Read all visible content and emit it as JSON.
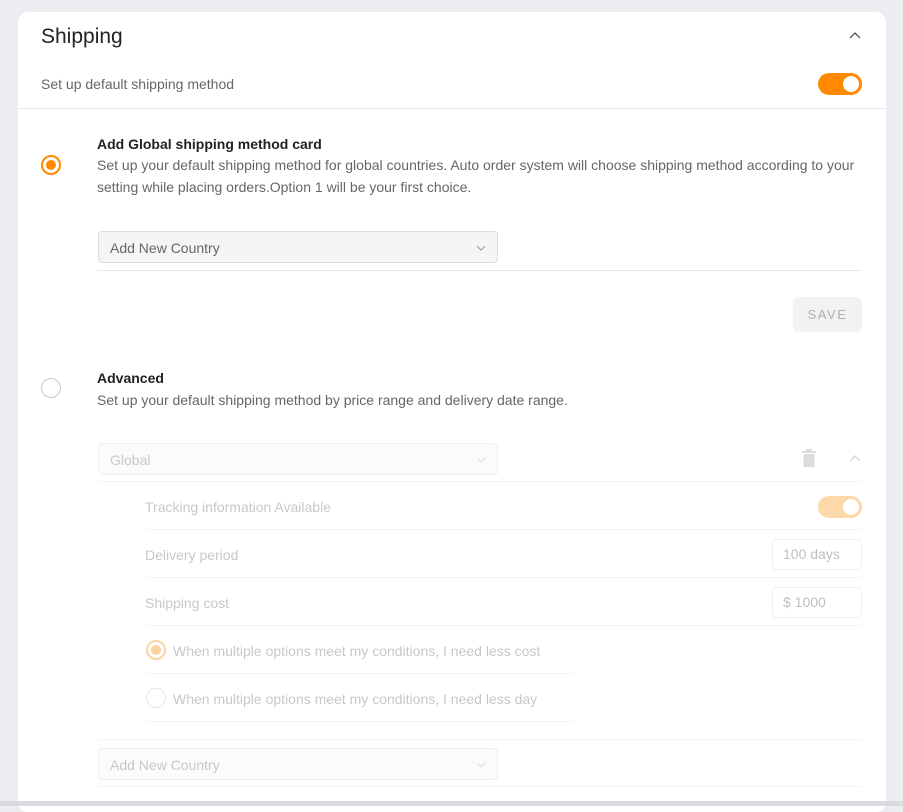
{
  "shipping": {
    "title": "Shipping",
    "default_label": "Set up default shipping method",
    "default_enabled": true
  },
  "global_option": {
    "title": "Add Global shipping method card",
    "description": "Set up your default shipping method for global countries. Auto order system will choose shipping method according to your setting while placing orders.Option 1 will be your first choice.",
    "select_placeholder": "Add New Country",
    "selected": true,
    "save_label": "SAVE"
  },
  "advanced_option": {
    "title": "Advanced",
    "description": "Set up your default shipping method by price range and delivery date range.",
    "selected": false,
    "region_select": "Global",
    "tracking_label": "Tracking information Available",
    "tracking_enabled": true,
    "delivery_label": "Delivery period",
    "delivery_value": "100 days",
    "cost_label": "Shipping cost",
    "cost_value": "$ 1000",
    "pref_less_cost": "When multiple options meet my conditions, I need less cost",
    "pref_less_day": "When multiple options meet my conditions, I need less day",
    "add_country_placeholder": "Add New Country"
  },
  "colors": {
    "accent": "#ff8a00",
    "accent_faded": "#fdd8a8"
  },
  "icons": {
    "collapse": "chevron-up-icon",
    "dropdown": "chevron-down-icon",
    "delete": "trash-icon"
  }
}
